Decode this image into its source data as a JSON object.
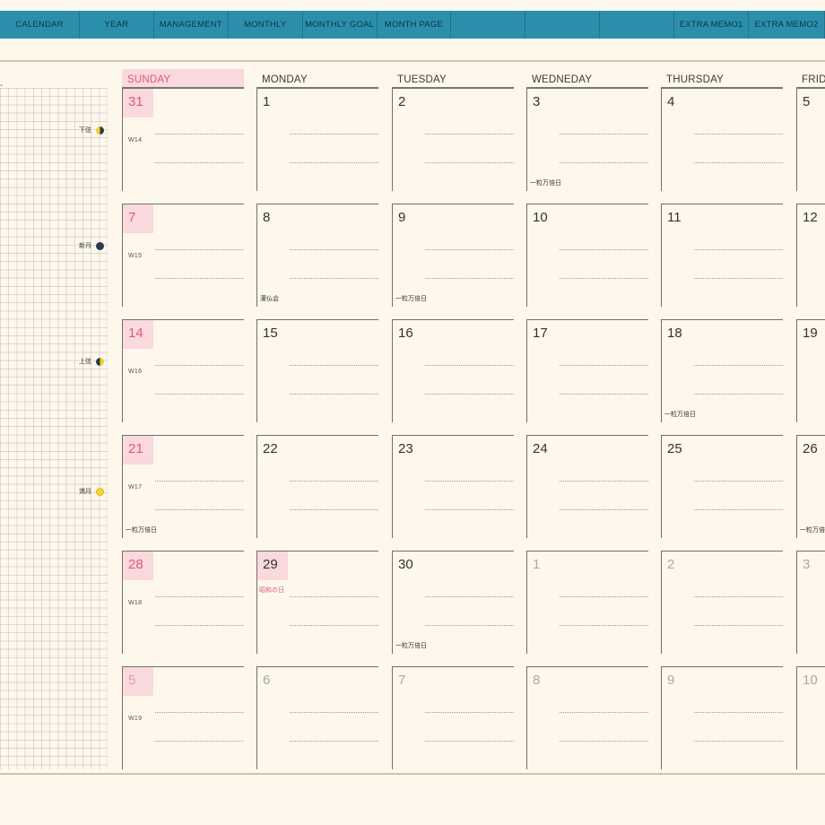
{
  "nav": {
    "items": [
      "CALENDAR",
      "YEAR",
      "MANAGEMENT",
      "MONTHLY",
      "MONTHLY GOAL",
      "MONTH PAGE",
      "",
      "",
      "",
      "EXTRA MEMO1",
      "EXTRA MEMO2"
    ]
  },
  "memo_panel": {
    "top_mark": "-",
    "moons": [
      {
        "label": "下弦",
        "icon": "last-quarter-moon-icon"
      },
      {
        "label": "新月",
        "icon": "new-moon-icon"
      },
      {
        "label": "上弦",
        "icon": "first-quarter-moon-icon"
      },
      {
        "label": "満月",
        "icon": "full-moon-icon"
      }
    ]
  },
  "weekdays": [
    "SUNDAY",
    "MONDAY",
    "TUESDAY",
    "WEDNEDAY",
    "THURSDAY",
    "FRIDAY"
  ],
  "weeks": [
    {
      "week_label": "W14",
      "days": [
        {
          "num": "31",
          "type": "sunday"
        },
        {
          "num": "1"
        },
        {
          "num": "2"
        },
        {
          "num": "3",
          "note": "一粒万倍日"
        },
        {
          "num": "4"
        },
        {
          "num": "5"
        }
      ]
    },
    {
      "week_label": "W15",
      "days": [
        {
          "num": "7",
          "type": "sunday"
        },
        {
          "num": "8",
          "note": "灌仏会"
        },
        {
          "num": "9",
          "note": "一粒万倍日"
        },
        {
          "num": "10"
        },
        {
          "num": "11"
        },
        {
          "num": "12"
        }
      ]
    },
    {
      "week_label": "W16",
      "days": [
        {
          "num": "14",
          "type": "sunday"
        },
        {
          "num": "15"
        },
        {
          "num": "16"
        },
        {
          "num": "17"
        },
        {
          "num": "18",
          "note": "一粒万倍日"
        },
        {
          "num": "19"
        }
      ]
    },
    {
      "week_label": "W17",
      "days": [
        {
          "num": "21",
          "type": "sunday",
          "note": "一粒万倍日"
        },
        {
          "num": "22"
        },
        {
          "num": "23"
        },
        {
          "num": "24"
        },
        {
          "num": "25"
        },
        {
          "num": "26",
          "note": "一粒万倍日"
        }
      ]
    },
    {
      "week_label": "W18",
      "days": [
        {
          "num": "28",
          "type": "sunday"
        },
        {
          "num": "29",
          "type": "holiday",
          "holiday": "昭和の日"
        },
        {
          "num": "30",
          "note": "一粒万倍日"
        },
        {
          "num": "1",
          "type": "dim"
        },
        {
          "num": "2",
          "type": "dim"
        },
        {
          "num": "3",
          "type": "dim"
        }
      ]
    },
    {
      "week_label": "W19",
      "days": [
        {
          "num": "5",
          "type": "sunday-dim"
        },
        {
          "num": "6",
          "type": "dim"
        },
        {
          "num": "7",
          "type": "dim"
        },
        {
          "num": "8",
          "type": "dim"
        },
        {
          "num": "9",
          "type": "dim"
        },
        {
          "num": "10",
          "type": "dim"
        }
      ]
    }
  ]
}
